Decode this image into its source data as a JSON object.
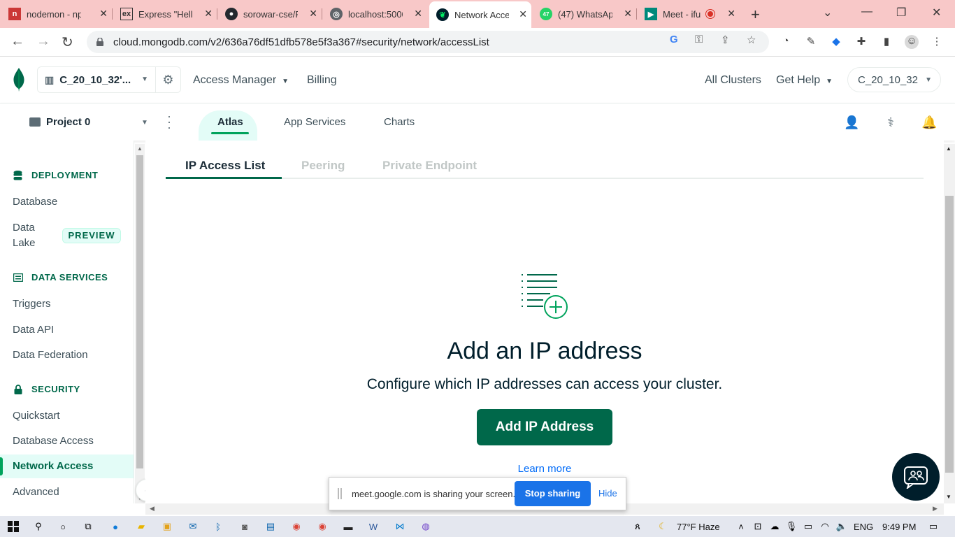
{
  "browser": {
    "tabs": [
      {
        "title": "nodemon - np",
        "favicon": "npm-icon",
        "color": "#cb3837"
      },
      {
        "title": "Express \"Hello",
        "favicon": "express-icon",
        "color": "#333333"
      },
      {
        "title": "sorowar-cse/F",
        "favicon": "github-icon",
        "color": "#24292f"
      },
      {
        "title": "localhost:5000",
        "favicon": "globe-icon",
        "color": "#5f6368"
      },
      {
        "title": "Network Acce",
        "favicon": "mongodb-leaf-icon",
        "color": "#00ed64"
      },
      {
        "title": "(47) WhatsAp",
        "favicon": "whatsapp-icon",
        "color": "#25d366",
        "badge": "47"
      },
      {
        "title": "Meet - ifu",
        "favicon": "meet-icon",
        "color": "#00897b"
      }
    ],
    "url": "cloud.mongodb.com/v2/636a76df51dfb578e5f3a367#security/network/accessList"
  },
  "header": {
    "org_name": "C_20_10_32'...",
    "nav": [
      "Access Manager",
      "Billing"
    ],
    "right_links": [
      "All Clusters",
      "Get Help"
    ],
    "user": "C_20_10_32"
  },
  "project_bar": {
    "project": "Project 0",
    "tabs": [
      "Atlas",
      "App Services",
      "Charts"
    ]
  },
  "sidebar": {
    "sections": [
      {
        "heading": "DEPLOYMENT",
        "icon": "database-icon"
      },
      {
        "heading": "DATA SERVICES",
        "icon": "data-services-icon"
      },
      {
        "heading": "SECURITY",
        "icon": "lock-icon"
      }
    ],
    "items": [
      "Database",
      "Data Lake",
      "Triggers",
      "Data API",
      "Data Federation",
      "Quickstart",
      "Database Access",
      "Network Access",
      "Advanced"
    ],
    "data_lake_line1": "Data",
    "data_lake_line2": "Lake",
    "preview_badge": "PREVIEW",
    "active": "Network Access"
  },
  "main": {
    "subtabs": [
      "IP Access List",
      "Peering",
      "Private Endpoint"
    ],
    "title": "Add an IP address",
    "subtitle": "Configure which IP addresses can access your cluster.",
    "button": "Add IP Address",
    "learn_more": "Learn more"
  },
  "share_banner": {
    "message": "meet.google.com is sharing your screen.",
    "stop": "Stop sharing",
    "hide": "Hide"
  },
  "taskbar": {
    "weather": "77°F  Haze",
    "lang": "ENG",
    "time": "9:49 PM"
  },
  "colors": {
    "accent": "#00684a",
    "accent_light": "#e3fcf7",
    "link": "#016bf8",
    "tabstrip": "#f8c8c8"
  }
}
